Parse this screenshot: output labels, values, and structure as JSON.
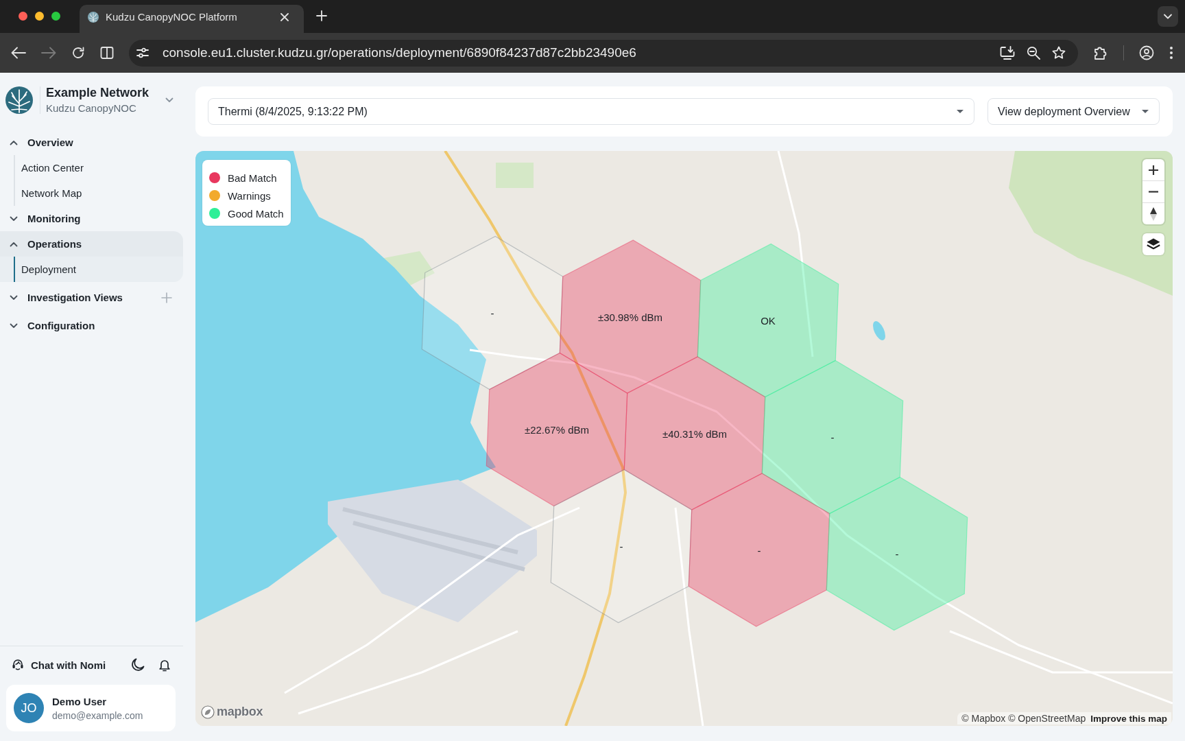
{
  "browser": {
    "tabs": [
      {
        "title": "Kudzu CanopyNOC Platform",
        "selected": true
      }
    ],
    "url": "console.eu1.cluster.kudzu.gr/operations/deployment/6890f84237d87c2bb23490e6"
  },
  "sidebar": {
    "workspace": {
      "name": "Example Network",
      "subtitle": "Kudzu CanopyNOC"
    },
    "nav": [
      {
        "label": "Overview",
        "expanded": true,
        "selected": false,
        "children": [
          {
            "label": "Action Center",
            "selected": false
          },
          {
            "label": "Network Map",
            "selected": false
          }
        ]
      },
      {
        "label": "Monitoring",
        "expanded": false,
        "selected": false
      },
      {
        "label": "Operations",
        "expanded": true,
        "selected": true,
        "children": [
          {
            "label": "Deployment",
            "selected": true
          }
        ]
      },
      {
        "label": "Investigation Views",
        "expanded": false,
        "selected": false,
        "add_button": true
      },
      {
        "label": "Configuration",
        "expanded": false,
        "selected": false
      }
    ],
    "chat_label": "Chat with Nomi",
    "user": {
      "initials": "JO",
      "name": "Demo User",
      "email": "demo@example.com"
    }
  },
  "filters": {
    "deployment_select": {
      "value": "Thermi (8/4/2025, 9:13:22 PM)"
    },
    "view_select": {
      "value": "View deployment Overview"
    }
  },
  "map": {
    "legend": [
      {
        "kind": "bad",
        "label": "Bad Match",
        "color": "#e8375e"
      },
      {
        "kind": "warning",
        "label": "Warnings",
        "color": "#f2aa2c"
      },
      {
        "kind": "good",
        "label": "Good Match",
        "color": "#2eef97"
      }
    ],
    "hex_rows": [
      [
        {
          "kind": "none",
          "label": "-"
        },
        {
          "kind": "bad",
          "label": "±30.98% dBm"
        },
        {
          "kind": "good",
          "label": "OK"
        }
      ],
      [
        {
          "kind": "bad",
          "label": "±22.67% dBm"
        },
        {
          "kind": "bad",
          "label": "±40.31% dBm"
        },
        {
          "kind": "good",
          "label": "-"
        }
      ],
      [
        {
          "kind": "none",
          "label": "-"
        },
        {
          "kind": "bad",
          "label": "-"
        },
        {
          "kind": "good",
          "label": "-"
        }
      ]
    ],
    "logo": "mapbox",
    "attribution": "© Mapbox © OpenStreetMap",
    "improve_link": "Improve this map"
  }
}
